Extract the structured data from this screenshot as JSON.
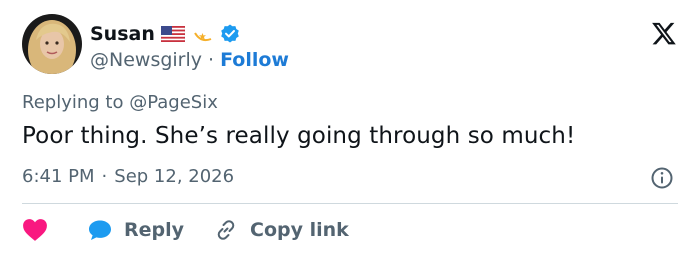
{
  "user": {
    "display_name": "Susan",
    "handle": "@Newsgirly",
    "separator": "·",
    "follow_label": "Follow",
    "badges": [
      "us-flag-emoji",
      "dizzy-star-emoji",
      "verified-badge-icon"
    ]
  },
  "replying": {
    "prefix": "Replying to",
    "mention": "@PageSix"
  },
  "tweet": {
    "text": "Poor thing. She’s really going through so much!",
    "time": "6:41 PM",
    "separator": "·",
    "date": "Sep 12, 2026"
  },
  "actions": {
    "like_icon": "heart-icon",
    "reply_label": "Reply",
    "copy_link_label": "Copy link"
  },
  "colors": {
    "accent": "#1d9bf0",
    "follow": "#1d7bd6",
    "heart": "#f91880",
    "muted": "#536471",
    "text": "#0f1419"
  }
}
